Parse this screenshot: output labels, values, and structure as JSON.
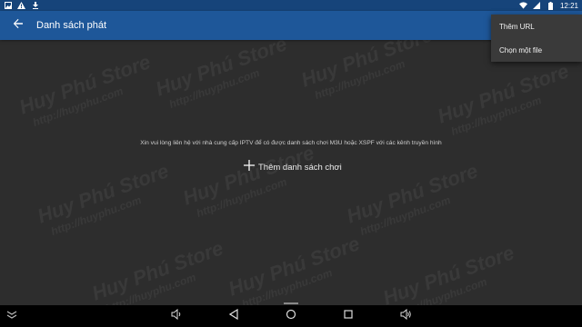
{
  "status_bar": {
    "time": "12:21",
    "left_icons": [
      "image-icon",
      "warning-icon",
      "download-icon"
    ],
    "right_icons": [
      "wifi-icon",
      "signal-icon",
      "battery-icon"
    ]
  },
  "app_bar": {
    "title": "Danh sách phát",
    "back_icon": "arrow-left-icon",
    "color": "#1e5799"
  },
  "overflow_menu": {
    "items": [
      {
        "label": "Thêm URL"
      },
      {
        "label": "Chọn một file"
      }
    ]
  },
  "main": {
    "message": "Xin vui lòng liên hệ với nhà cung cấp IPTV để có được danh sách chơi M3U hoặc XSPF với các kênh truyền hình",
    "add_playlist_label": "Thêm danh sách chơi"
  },
  "watermark": {
    "title": "Huy Phú Store",
    "url": "http://huyphu.com"
  },
  "nav_bar": {
    "buttons": [
      "collapse-icon",
      "volume-down-icon",
      "back-triangle-icon",
      "home-circle-icon",
      "recents-square-icon",
      "volume-up-icon"
    ]
  }
}
